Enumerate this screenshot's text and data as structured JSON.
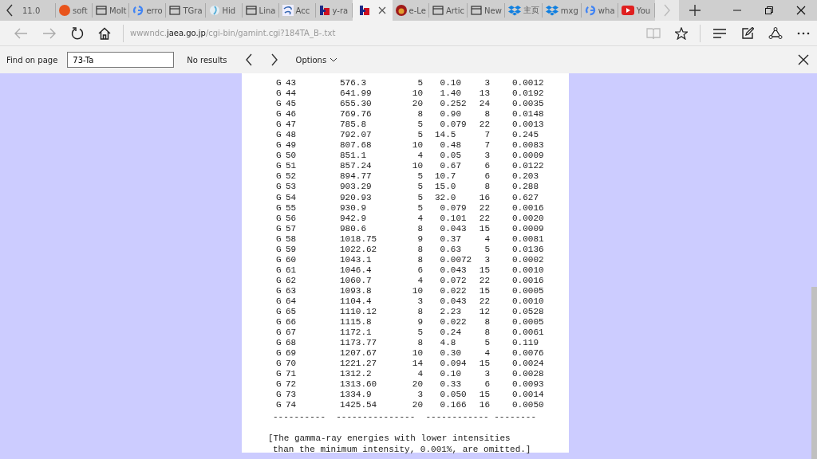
{
  "tabs": [
    {
      "label": "11.0",
      "kind": "text",
      "selected": false
    },
    {
      "label": "soft",
      "kind": "ask",
      "selected": false
    },
    {
      "label": "Molt",
      "kind": "page",
      "selected": false
    },
    {
      "label": "erro",
      "kind": "google",
      "selected": false
    },
    {
      "label": "TGra",
      "kind": "page",
      "selected": false
    },
    {
      "label": "Hid",
      "kind": "cloud",
      "selected": false
    },
    {
      "label": "Lina",
      "kind": "page",
      "selected": false
    },
    {
      "label": "Acc",
      "kind": "swirl",
      "selected": false
    },
    {
      "label": "y-ra",
      "kind": "hb",
      "selected": false
    },
    {
      "kind": "hb",
      "selected": true
    },
    {
      "label": "e-Le",
      "kind": "red",
      "selected": false
    },
    {
      "label": "Artic",
      "kind": "page",
      "selected": false
    },
    {
      "label": "New",
      "kind": "page",
      "selected": false
    },
    {
      "label": "主页",
      "kind": "dropbox",
      "selected": false
    },
    {
      "label": "mxg",
      "kind": "dropbox",
      "selected": false
    },
    {
      "label": "wha",
      "kind": "google",
      "selected": false
    },
    {
      "label": "You",
      "kind": "youtube",
      "selected": false
    }
  ],
  "address": {
    "host_prefix": "wwwndc.",
    "host": "jaea.go.jp",
    "path": "/cgi-bin/gamint.cgi?184TA_B-.txt"
  },
  "find_bar": {
    "label": "Find on page",
    "value": "73-Ta",
    "result": "No results",
    "options": "Options"
  },
  "table": {
    "rows": [
      [
        "G",
        "43",
        "576.3",
        "5",
        "0.10",
        "3",
        "0.0012"
      ],
      [
        "G",
        "44",
        "641.99",
        "10",
        "1.40",
        "13",
        "0.0192"
      ],
      [
        "G",
        "45",
        "655.30",
        "20",
        "0.252",
        "24",
        "0.0035"
      ],
      [
        "G",
        "46",
        "769.76",
        "8",
        "0.90",
        "8",
        "0.0148"
      ],
      [
        "G",
        "47",
        "785.8",
        "5",
        "0.079",
        "22",
        "0.0013"
      ],
      [
        "G",
        "48",
        "792.07",
        "5",
        "14.5",
        "7",
        "0.245"
      ],
      [
        "G",
        "49",
        "807.68",
        "10",
        "0.48",
        "7",
        "0.0083"
      ],
      [
        "G",
        "50",
        "851.1",
        "4",
        "0.05",
        "3",
        "0.0009"
      ],
      [
        "G",
        "51",
        "857.24",
        "10",
        "0.67",
        "6",
        "0.0122"
      ],
      [
        "G",
        "52",
        "894.77",
        "5",
        "10.7",
        "6",
        "0.203"
      ],
      [
        "G",
        "53",
        "903.29",
        "5",
        "15.0",
        "8",
        "0.288"
      ],
      [
        "G",
        "54",
        "920.93",
        "5",
        "32.0",
        "16",
        "0.627"
      ],
      [
        "G",
        "55",
        "930.9",
        "5",
        "0.079",
        "22",
        "0.0016"
      ],
      [
        "G",
        "56",
        "942.9",
        "4",
        "0.101",
        "22",
        "0.0020"
      ],
      [
        "G",
        "57",
        "980.6",
        "8",
        "0.043",
        "15",
        "0.0009"
      ],
      [
        "G",
        "58",
        "1018.75",
        "9",
        "0.37",
        "4",
        "0.0081"
      ],
      [
        "G",
        "59",
        "1022.62",
        "8",
        "0.63",
        "5",
        "0.0136"
      ],
      [
        "G",
        "60",
        "1043.1",
        "8",
        "0.0072",
        "3",
        "0.0002"
      ],
      [
        "G",
        "61",
        "1046.4",
        "6",
        "0.043",
        "15",
        "0.0010"
      ],
      [
        "G",
        "62",
        "1060.7",
        "4",
        "0.072",
        "22",
        "0.0016"
      ],
      [
        "G",
        "63",
        "1093.8",
        "10",
        "0.022",
        "15",
        "0.0005"
      ],
      [
        "G",
        "64",
        "1104.4",
        "3",
        "0.043",
        "22",
        "0.0010"
      ],
      [
        "G",
        "65",
        "1110.12",
        "8",
        "2.23",
        "12",
        "0.0528"
      ],
      [
        "G",
        "66",
        "1115.8",
        "9",
        "0.022",
        "8",
        "0.0005"
      ],
      [
        "G",
        "67",
        "1172.1",
        "5",
        "0.24",
        "8",
        "0.0061"
      ],
      [
        "G",
        "68",
        "1173.77",
        "8",
        "4.8",
        "5",
        "0.119"
      ],
      [
        "G",
        "69",
        "1207.67",
        "10",
        "0.30",
        "4",
        "0.0076"
      ],
      [
        "G",
        "70",
        "1221.27",
        "14",
        "0.094",
        "15",
        "0.0024"
      ],
      [
        "G",
        "71",
        "1312.2",
        "4",
        "0.10",
        "3",
        "0.0028"
      ],
      [
        "G",
        "72",
        "1313.60",
        "20",
        "0.33",
        "6",
        "0.0093"
      ],
      [
        "G",
        "73",
        "1334.9",
        "3",
        "0.050",
        "15",
        "0.0014"
      ],
      [
        "G",
        "74",
        "1425.54",
        "20",
        "0.166",
        "16",
        "0.0050"
      ]
    ],
    "rule": "----------  ---------------  ------------ --------"
  },
  "note": [
    "[The gamma-ray energies with lower intensities",
    "than the minimum intensity, 0.001%, are omitted.]"
  ]
}
